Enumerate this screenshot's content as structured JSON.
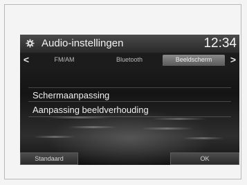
{
  "title_bar": {
    "icon": "gear-icon",
    "title": "Audio-instellingen",
    "clock": "12:34"
  },
  "tabs": [
    {
      "label": "FM/AM",
      "active": false
    },
    {
      "label": "Bluetooth",
      "active": false
    },
    {
      "label": "Beeldscherm",
      "active": true
    }
  ],
  "nav": {
    "prev": "<",
    "next": ">"
  },
  "menu": {
    "items": [
      {
        "label": "Schermaanpassing"
      },
      {
        "label": "Aanpassing beeldverhouding"
      }
    ]
  },
  "buttons": {
    "default_label": "Standaard",
    "ok_label": "OK"
  },
  "colors": {
    "screen_bg": "#1a1a1a",
    "active_tab": "#7a7a7a",
    "text": "#f0f0f0"
  }
}
